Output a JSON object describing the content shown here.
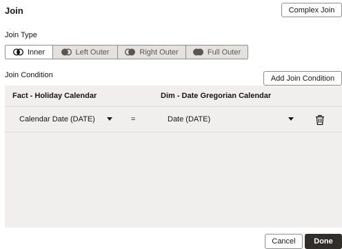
{
  "dialog": {
    "title": "Join"
  },
  "complex_join_label": "Complex Join",
  "join_type": {
    "label": "Join Type",
    "options": [
      {
        "label": "Inner",
        "icon": "inner-join-icon",
        "selected": true
      },
      {
        "label": "Left Outer",
        "icon": "left-outer-join-icon",
        "selected": false
      },
      {
        "label": "Right Outer",
        "icon": "right-outer-join-icon",
        "selected": false
      },
      {
        "label": "Full Outer",
        "icon": "full-outer-join-icon",
        "selected": false
      }
    ]
  },
  "join_condition": {
    "label": "Join Condition",
    "add_label": "Add Join Condition",
    "left_header": "Fact - Holiday Calendar",
    "right_header": "Dim - Date Gregorian Calendar",
    "rows": [
      {
        "left": "Calendar Date (DATE)",
        "operator": "=",
        "right": "Date (DATE)",
        "delete_icon": "trash-icon"
      }
    ]
  },
  "footer": {
    "cancel_label": "Cancel",
    "done_label": "Done"
  },
  "colors": {
    "primary_button": "#312d2a",
    "panel_bg": "#f1efed",
    "segment_inactive": "#e4e2df"
  }
}
